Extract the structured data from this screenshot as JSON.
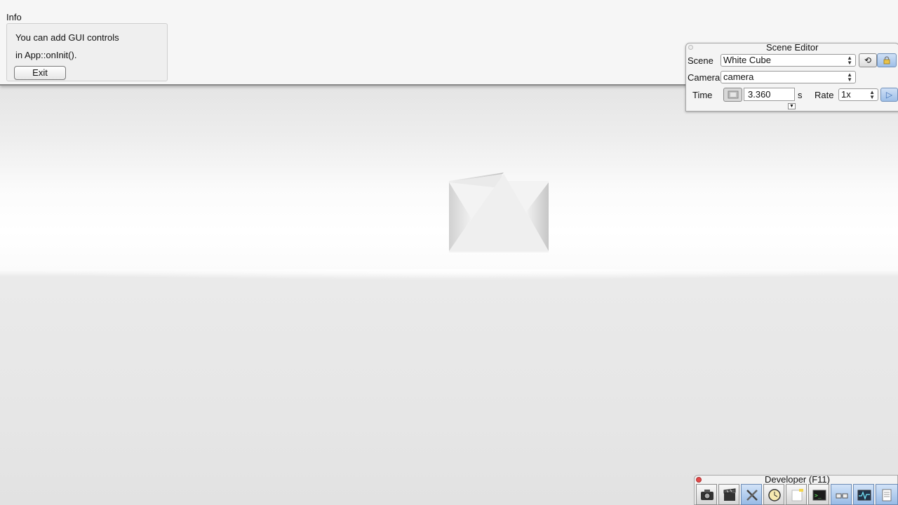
{
  "info": {
    "title": "Info",
    "line1": "You can add GUI controls",
    "line2": "in App::onInit().",
    "exit_label": "Exit"
  },
  "scene_editor": {
    "title": "Scene Editor",
    "scene_label": "Scene",
    "scene_value": "White Cube",
    "camera_label": "Camera",
    "camera_value": "camera",
    "time_label": "Time",
    "time_value": "3.360",
    "time_unit": "s",
    "rate_label": "Rate",
    "rate_value": "1x"
  },
  "developer": {
    "title": "Developer (F11)",
    "tools": [
      "camera-icon",
      "clapperboard-icon",
      "tools-icon",
      "clock-icon",
      "note-icon",
      "terminal-icon",
      "network-icon",
      "profiler-icon",
      "log-icon"
    ]
  },
  "colors": {
    "accent_blue": "#9ebfe8",
    "close_red": "#e34a4a"
  }
}
